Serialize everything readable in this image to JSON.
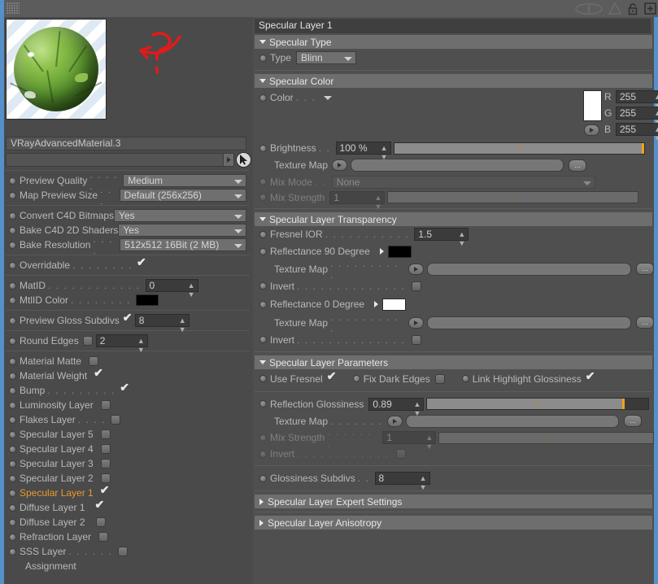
{
  "window": {
    "top_icons": [
      "ghost-shape-icon",
      "cone-icon",
      "lock-icon",
      "add-panel-icon"
    ]
  },
  "left_panel": {
    "material_name": "VRayAdvancedMaterial.3",
    "link_field_value": "",
    "preview_label": "material-preview",
    "settings": [
      {
        "label": "Preview Quality",
        "dots": ". . . . .",
        "type": "combo",
        "value": "Medium"
      },
      {
        "label": "Map Preview Size",
        "dots": ". . .",
        "type": "combo",
        "value": "Default (256x256)"
      },
      {
        "label": "Convert C4D Bitmaps",
        "dots": "",
        "type": "combo",
        "value": "Yes"
      },
      {
        "label": "Bake C4D 2D Shaders",
        "dots": "",
        "type": "combo",
        "value": "Yes"
      },
      {
        "label": "Bake Resolution",
        "dots": ". . . .",
        "type": "combo",
        "value": "512x512   16Bit   (2 MB)"
      },
      {
        "label": "Overridable",
        "dots": ". . . . . . . .",
        "type": "check",
        "value": true
      },
      {
        "label": "MatID",
        "dots": ". . . . . . . . . . . .",
        "type": "num",
        "value": "0"
      },
      {
        "label": "MtlID Color",
        "dots": ". . . . . . . .",
        "type": "swatch",
        "value": "#000000"
      },
      {
        "label": "Preview Gloss Subdivs",
        "dots": "",
        "type": "check-num",
        "value": true,
        "num": "8"
      },
      {
        "label": "Round Edges",
        "dots": "",
        "type": "check-num",
        "value": false,
        "num": "2"
      }
    ],
    "layers": [
      {
        "label": "Material Matte",
        "dots": "",
        "checked": false,
        "active": false
      },
      {
        "label": "Material Weight",
        "dots": "",
        "checked": true,
        "active": false
      },
      {
        "label": "Bump",
        "dots": ". . . . . . . . .",
        "checked": true,
        "active": false
      },
      {
        "label": "Luminosity Layer",
        "dots": "",
        "checked": false,
        "active": false
      },
      {
        "label": "Flakes Layer",
        "dots": ". . . .",
        "checked": false,
        "active": false
      },
      {
        "label": "Specular Layer 5",
        "dots": "",
        "checked": false,
        "active": false
      },
      {
        "label": "Specular Layer 4",
        "dots": "",
        "checked": false,
        "active": false
      },
      {
        "label": "Specular Layer 3",
        "dots": "",
        "checked": false,
        "active": false
      },
      {
        "label": "Specular Layer 2",
        "dots": "",
        "checked": false,
        "active": false
      },
      {
        "label": "Specular Layer 1",
        "dots": "",
        "checked": true,
        "active": true
      },
      {
        "label": "Diffuse Layer 1",
        "dots": "",
        "checked": true,
        "active": false
      },
      {
        "label": "Diffuse Layer 2",
        "dots": "",
        "checked": false,
        "active": false
      },
      {
        "label": "Refraction Layer",
        "dots": "",
        "checked": false,
        "active": false
      },
      {
        "label": "SSS Layer",
        "dots": ". . . . . .",
        "checked": false,
        "active": false
      }
    ],
    "assignment_label": "Assignment"
  },
  "right_panel": {
    "title": "Specular Layer 1",
    "sections": {
      "specular_type": {
        "title": "Specular Type",
        "expanded": true,
        "type_label": "Type",
        "type_value": "Blinn"
      },
      "specular_color": {
        "title": "Specular Color",
        "expanded": true,
        "color_label": "Color",
        "color_dots": ". . .",
        "color_swatch": "#ffffff",
        "channels": [
          {
            "name": "R",
            "value": "255",
            "slider_pct": 100,
            "color": "#ff1a1a"
          },
          {
            "name": "G",
            "value": "255",
            "slider_pct": 100,
            "color": "#1aff3a"
          },
          {
            "name": "B",
            "value": "255",
            "slider_pct": 100,
            "color": "#2a2aff"
          }
        ],
        "brightness_label": "Brightness",
        "brightness_dots": ". .",
        "brightness_value": "100 %",
        "brightness_pct": 100,
        "brightness_tick_pct": 50,
        "texture_map_label": "Texture Map",
        "texture_map_value": "",
        "texture_map_browse": "...",
        "mix_mode_label": "Mix Mode",
        "mix_mode_dots": ". .",
        "mix_mode_value": "None",
        "mix_strength_label": "Mix Strength",
        "mix_strength_value": "1",
        "mix_strength_pct": 100,
        "mix_strength_tick_pct": 50
      },
      "specular_transparency": {
        "title": "Specular Layer Transparency",
        "expanded": true,
        "fresnel_ior_label": "Fresnel IOR",
        "fresnel_ior_dots": ". . . . . . . . . . .",
        "fresnel_ior_value": "1.5",
        "refl90_label": "Reflectance 90 Degree",
        "refl90_swatch": "#000000",
        "refl90_texture_label": "Texture Map",
        "refl90_texture_dots": ". . . . . . . . . .",
        "refl90_invert_label": "Invert",
        "refl90_invert_dots": ". . . . . . . . . . . . . .",
        "refl90_invert": false,
        "refl0_label": "Reflectance   0 Degree",
        "refl0_swatch": "#ffffff",
        "refl0_texture_label": "Texture Map",
        "refl0_texture_dots": ". . . . . . . . . .",
        "refl0_invert_label": "Invert",
        "refl0_invert_dots": ". . . . . . . . . . . . . .",
        "refl0_invert": false,
        "browse": "..."
      },
      "specular_parameters": {
        "title": "Specular Layer Parameters",
        "expanded": true,
        "use_fresnel_label": "Use Fresnel",
        "use_fresnel": true,
        "fix_dark_edges_label": "Fix Dark Edges",
        "fix_dark_edges": false,
        "link_highlight_label": "Link Highlight Glossiness",
        "link_highlight": true,
        "reflection_glossiness_label": "Reflection Glossiness",
        "reflection_glossiness_value": "0.89",
        "reflection_glossiness_pct": 89,
        "reflection_glossiness_tick_pct": 50,
        "texture_map_label": "Texture Map",
        "texture_map_dots": ". . . . . . .",
        "browse": "...",
        "mix_strength_label": "Mix Strength",
        "mix_strength_dots": ". . . . . . .",
        "mix_strength_value": "1",
        "mix_strength_pct": 100,
        "mix_strength_tick_pct": 50,
        "invert_label": "Invert",
        "invert_dots": ". . . . . . . . . . . .",
        "invert": false,
        "glossiness_subdivs_label": "Glossiness Subdivs",
        "glossiness_subdivs_dots": ". .",
        "glossiness_subdivs_value": "8"
      },
      "expert_settings": {
        "title": "Specular Layer Expert Settings",
        "expanded": false
      },
      "anisotropy": {
        "title": "Specular Layer Anisotropy",
        "expanded": false
      }
    }
  },
  "colors": {
    "accent_blue": "#5591c8",
    "highlight_orange": "#e79b2f",
    "slider_knob": "#f0a21b",
    "annotation_red": "#e01b1b"
  }
}
